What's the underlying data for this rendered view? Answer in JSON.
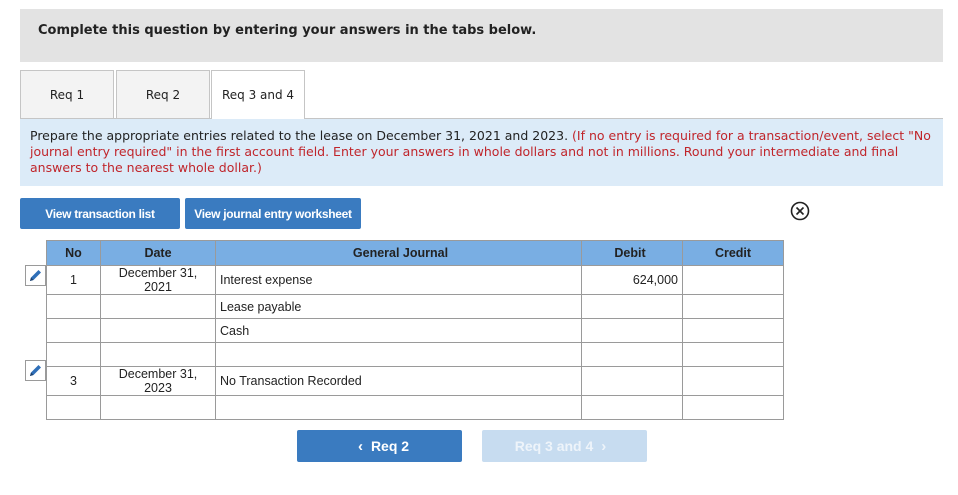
{
  "header": {
    "title": "Complete this question by entering your answers in the tabs below."
  },
  "tabs": [
    {
      "label": "Req 1"
    },
    {
      "label": "Req 2"
    },
    {
      "label": "Req 3 and 4"
    }
  ],
  "instructions": {
    "main": "Prepare the appropriate entries related to the lease on December 31, 2021 and 2023.",
    "note": "(If no entry is required for a transaction/event, select \"No journal entry required\" in the first account field. Enter your answers in whole dollars and not in millions. Round your intermediate and final answers to the nearest whole dollar.)"
  },
  "buttons": {
    "view_transaction_list": "View transaction list",
    "view_journal_worksheet": "View journal entry worksheet"
  },
  "journal": {
    "headers": {
      "no": "No",
      "date": "Date",
      "general_journal": "General Journal",
      "debit": "Debit",
      "credit": "Credit"
    },
    "entries": [
      {
        "no": "1",
        "date_line1": "December 31,",
        "date_line2": "2021",
        "account": "Interest expense",
        "debit": "624,000",
        "credit": ""
      },
      {
        "no": "",
        "date_line1": "",
        "date_line2": "",
        "account": "Lease payable",
        "debit": "",
        "credit": ""
      },
      {
        "no": "",
        "date_line1": "",
        "date_line2": "",
        "account": "Cash",
        "debit": "",
        "credit": ""
      },
      {
        "no": "",
        "date_line1": "",
        "date_line2": "",
        "account": "",
        "debit": "",
        "credit": ""
      },
      {
        "no": "3",
        "date_line1": "December 31,",
        "date_line2": "2023",
        "account": "No Transaction Recorded",
        "debit": "",
        "credit": ""
      },
      {
        "no": "",
        "date_line1": "",
        "date_line2": "",
        "account": "",
        "debit": "",
        "credit": ""
      }
    ]
  },
  "navigation": {
    "prev_label": "Req 2",
    "next_label": "Req 3 and 4"
  },
  "icons": {
    "close": "close-circle-icon",
    "edit": "pencil-icon"
  },
  "colors": {
    "accent": "#3a7bc0",
    "header_row": "#79aee3",
    "instruction_bg": "#dcebf8",
    "note_red": "#c0252b"
  }
}
